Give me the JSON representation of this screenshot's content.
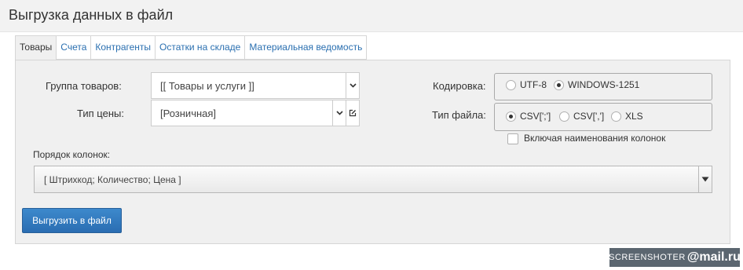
{
  "page": {
    "title": "Выгрузка данных в файл"
  },
  "tabs": [
    {
      "label": "Товары",
      "active": true
    },
    {
      "label": "Счета"
    },
    {
      "label": "Контрагенты"
    },
    {
      "label": "Остатки на складе"
    },
    {
      "label": "Материальная ведомость"
    }
  ],
  "form": {
    "group": {
      "label": "Группа товаров:",
      "value": "[[ Товары и услуги ]]"
    },
    "price_type": {
      "label": "Тип цены:",
      "value": "[Розничная]"
    },
    "encoding": {
      "label": "Кодировка:",
      "options": [
        {
          "label": "UTF-8",
          "selected": false
        },
        {
          "label": "WINDOWS-1251",
          "selected": true
        }
      ]
    },
    "file_type": {
      "label": "Тип файла:",
      "options": [
        {
          "label": "CSV[';']",
          "selected": true
        },
        {
          "label": "CSV[',']",
          "selected": false
        },
        {
          "label": "XLS",
          "selected": false
        }
      ]
    },
    "include_headers": {
      "label": "Включая наименования колонок",
      "checked": false
    },
    "column_order": {
      "label": "Порядок колонок:",
      "value": "[ Штрихкод; Количество; Цена ]"
    },
    "export_button": "Выгрузить в файл"
  },
  "watermark": {
    "part1": "SCREENSHOTER",
    "part2": "@mail.ru"
  },
  "colors": {
    "accent": "#2f7bbf",
    "tab_link": "#2a6fb0",
    "panel_bg": "#f0f0f0"
  },
  "icons": {
    "caret": "chevron-down-icon",
    "edit": "edit-icon",
    "dropdown": "triangle-down-icon"
  }
}
